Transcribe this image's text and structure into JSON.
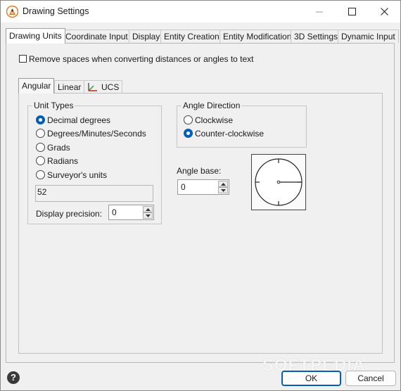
{
  "window": {
    "title": "Drawing Settings"
  },
  "tabs": [
    {
      "label": "Drawing Units",
      "active": true
    },
    {
      "label": "Coordinate Input"
    },
    {
      "label": "Display"
    },
    {
      "label": "Entity Creation"
    },
    {
      "label": "Entity Modification"
    },
    {
      "label": "3D Settings"
    },
    {
      "label": "Dynamic Input"
    }
  ],
  "remove_spaces": {
    "label": "Remove spaces when converting distances or angles to text",
    "checked": false
  },
  "subtabs": [
    {
      "label": "Angular",
      "active": true
    },
    {
      "label": "Linear"
    },
    {
      "label": "UCS"
    }
  ],
  "unit_types": {
    "legend": "Unit Types",
    "options": [
      {
        "label": "Decimal degrees",
        "selected": true
      },
      {
        "label": "Degrees/Minutes/Seconds"
      },
      {
        "label": "Grads"
      },
      {
        "label": "Radians"
      },
      {
        "label": "Surveyor's units"
      }
    ],
    "sample": "52",
    "precision_label": "Display precision:",
    "precision_value": "0"
  },
  "angle_direction": {
    "legend": "Angle Direction",
    "options": [
      {
        "label": "Clockwise"
      },
      {
        "label": "Counter-clockwise",
        "selected": true
      }
    ]
  },
  "angle_base": {
    "label": "Angle base:",
    "value": "0",
    "dial_angle_deg": 0
  },
  "buttons": {
    "ok": "OK",
    "cancel": "Cancel",
    "help": "?"
  },
  "watermark": "SOFTPEDIA",
  "colors": {
    "accent": "#005fb8",
    "app_icon": "#e87722"
  }
}
